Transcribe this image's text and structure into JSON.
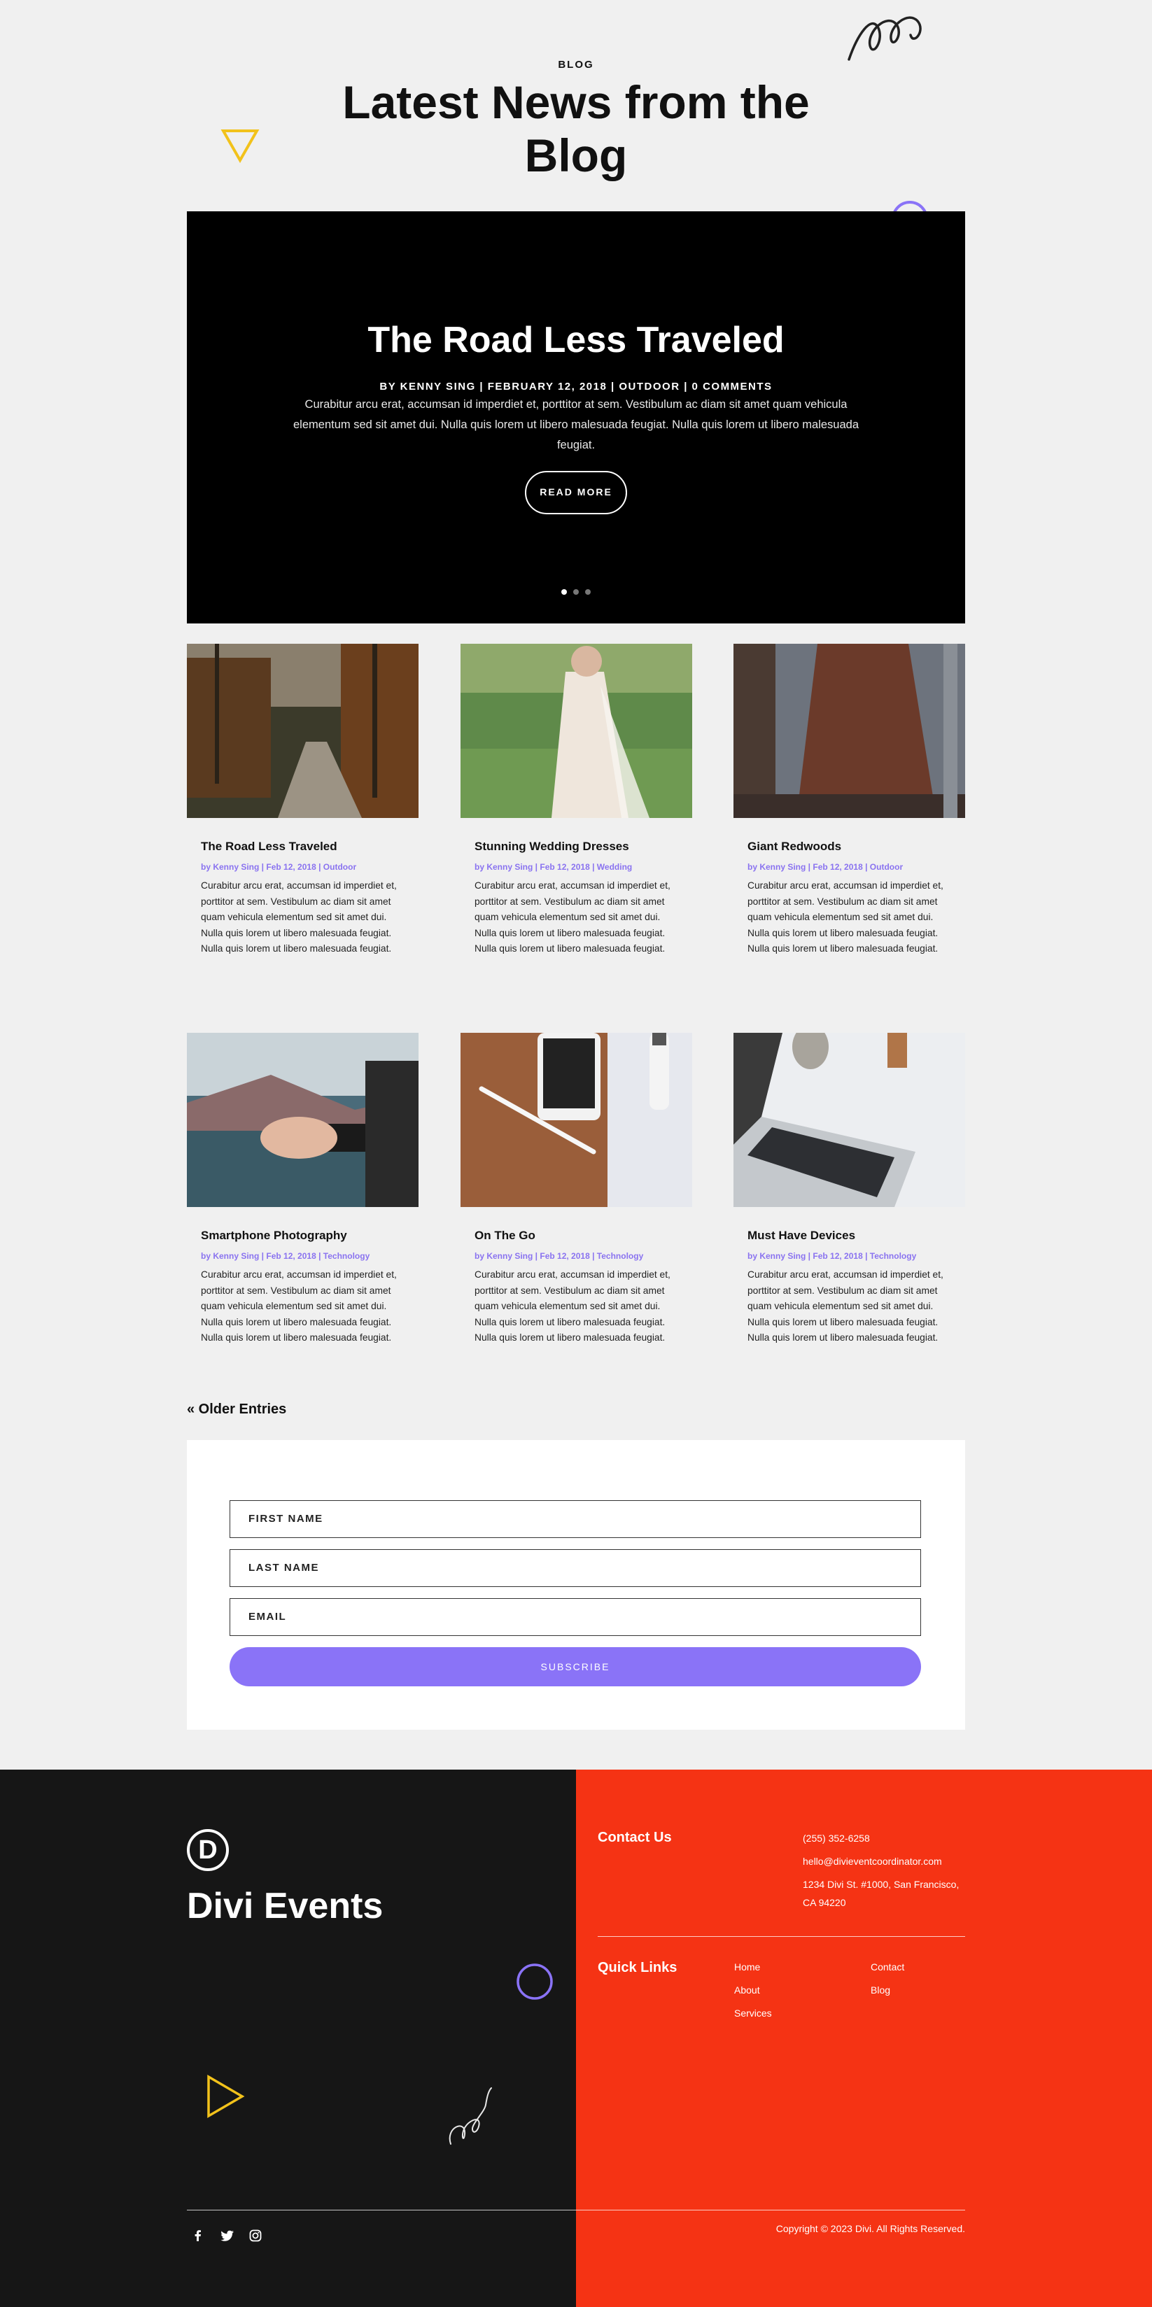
{
  "header": {
    "eyebrow": "BLOG",
    "title": "Latest News from the Blog"
  },
  "slider": {
    "title": "The Road Less Traveled",
    "meta": "BY KENNY SING | FEBRUARY 12, 2018 | OUTDOOR | 0 COMMENTS",
    "excerpt": "Curabitur arcu erat, accumsan id imperdiet et, porttitor at sem. Vestibulum ac diam sit amet quam vehicula elementum sed sit amet dui. Nulla quis lorem ut libero malesuada feugiat. Nulla quis lorem ut libero malesuada feugiat.",
    "button": "READ MORE",
    "active_slide": 1,
    "slide_count": 3
  },
  "posts": [
    {
      "title": "The Road Less Traveled",
      "author": "by Kenny Sing",
      "date": "Feb 12, 2018",
      "category": "Outdoor",
      "image": "forest-path-photo",
      "excerpt": "Curabitur arcu erat, accumsan id imperdiet et, porttitor at sem. Vestibulum ac diam sit amet quam vehicula elementum sed sit amet dui. Nulla quis lorem ut libero malesuada feugiat. Nulla quis lorem ut libero malesuada feugiat."
    },
    {
      "title": "Stunning Wedding Dresses",
      "author": "by Kenny Sing",
      "date": "Feb 12, 2018",
      "category": "Wedding",
      "image": "bride-dress-photo",
      "excerpt": "Curabitur arcu erat, accumsan id imperdiet et, porttitor at sem. Vestibulum ac diam sit amet quam vehicula elementum sed sit amet dui. Nulla quis lorem ut libero malesuada feugiat. Nulla quis lorem ut libero malesuada feugiat."
    },
    {
      "title": "Giant Redwoods",
      "author": "by Kenny Sing",
      "date": "Feb 12, 2018",
      "category": "Outdoor",
      "image": "redwood-tree-photo",
      "excerpt": "Curabitur arcu erat, accumsan id imperdiet et, porttitor at sem. Vestibulum ac diam sit amet quam vehicula elementum sed sit amet dui. Nulla quis lorem ut libero malesuada feugiat. Nulla quis lorem ut libero malesuada feugiat."
    },
    {
      "title": "Smartphone Photography",
      "author": "by Kenny Sing",
      "date": "Feb 12, 2018",
      "category": "Technology",
      "image": "phone-photography-photo",
      "excerpt": "Curabitur arcu erat, accumsan id imperdiet et, porttitor at sem. Vestibulum ac diam sit amet quam vehicula elementum sed sit amet dui. Nulla quis lorem ut libero malesuada feugiat. Nulla quis lorem ut libero malesuada feugiat."
    },
    {
      "title": "On The Go",
      "author": "by Kenny Sing",
      "date": "Feb 12, 2018",
      "category": "Technology",
      "image": "phone-tablet-photo",
      "excerpt": "Curabitur arcu erat, accumsan id imperdiet et, porttitor at sem. Vestibulum ac diam sit amet quam vehicula elementum sed sit amet dui. Nulla quis lorem ut libero malesuada feugiat. Nulla quis lorem ut libero malesuada feugiat."
    },
    {
      "title": "Must Have Devices",
      "author": "by Kenny Sing",
      "date": "Feb 12, 2018",
      "category": "Technology",
      "image": "laptop-keyboard-photo",
      "excerpt": "Curabitur arcu erat, accumsan id imperdiet et, porttitor at sem. Vestibulum ac diam sit amet quam vehicula elementum sed sit amet dui. Nulla quis lorem ut libero malesuada feugiat. Nulla quis lorem ut libero malesuada feugiat."
    }
  ],
  "pagination": {
    "older": "« Older Entries"
  },
  "subscribe": {
    "first_name": "FIRST NAME",
    "last_name": "LAST NAME",
    "email": "EMAIL",
    "button": "SUBSCRIBE"
  },
  "footer": {
    "logo_letter": "D",
    "brand": "Divi Events",
    "contact_heading": "Contact Us",
    "phone": "(255) 352-6258",
    "email": "hello@divieventcoordinator.com",
    "address": "1234 Divi St. #1000, San Francisco, CA 94220",
    "links_heading": "Quick Links",
    "links": [
      "Home",
      "Contact",
      "About",
      "Blog",
      "Services"
    ],
    "social": [
      "facebook-icon",
      "twitter-icon",
      "instagram-icon"
    ],
    "copyright": "Copyright © 2023 Divi. All Rights Reserved."
  },
  "colors": {
    "accent": "#8a73f7",
    "footer_dark": "#161616",
    "footer_orange": "#f53314",
    "deco_yellow": "#f2c21b"
  }
}
